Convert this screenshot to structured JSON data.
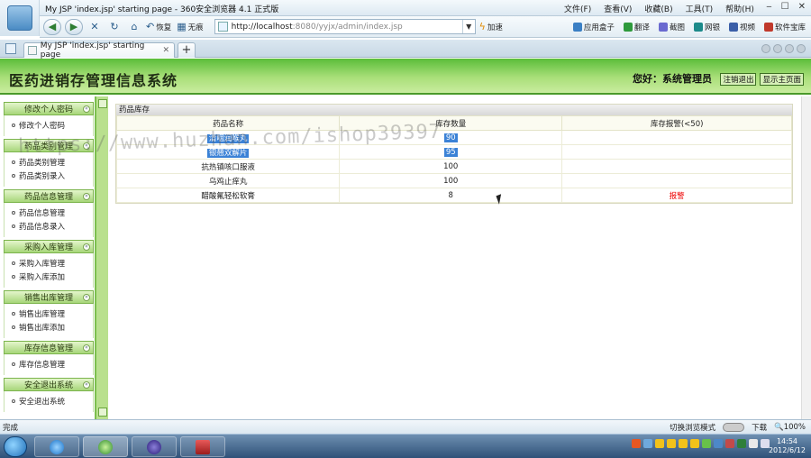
{
  "browser": {
    "window_title": "My JSP 'index.jsp' starting page - 360安全浏览器 4.1 正式版",
    "menus": [
      "文件(F)",
      "查看(V)",
      "收藏(B)",
      "工具(T)",
      "帮助(H)"
    ],
    "toolbar": {
      "restore": "恢复",
      "trace": "无痕",
      "speed": "加速",
      "url_host": "http://localhost",
      "url_rest": ":8080/yyjx/admin/index.jsp",
      "apps": [
        "应用盒子",
        "翻译",
        "截图",
        "网银",
        "视频",
        "软件宝库"
      ]
    },
    "tab": {
      "label": "My JSP 'index.jsp' starting page"
    },
    "status": {
      "left": "完成",
      "compat": "切换浏览模式",
      "download": "下载",
      "zoom": "100%"
    }
  },
  "app": {
    "title": "医药进销存管理信息系统",
    "greeting": "您好：系统管理员",
    "links": {
      "logout": "注销退出",
      "home": "显示主页面"
    }
  },
  "sidebar": [
    {
      "title": "修改个人密码",
      "items": [
        "修改个人密码"
      ]
    },
    {
      "title": "药品类别管理",
      "items": [
        "药品类别管理",
        "药品类别录入"
      ]
    },
    {
      "title": "药品信息管理",
      "items": [
        "药品信息管理",
        "药品信息录入"
      ]
    },
    {
      "title": "采购入库管理",
      "items": [
        "采购入库管理",
        "采购入库添加"
      ]
    },
    {
      "title": "销售出库管理",
      "items": [
        "销售出库管理",
        "销售出库添加"
      ]
    },
    {
      "title": "库存信息管理",
      "items": [
        "库存信息管理"
      ]
    },
    {
      "title": "安全退出系统",
      "items": [
        "安全退出系统"
      ]
    }
  ],
  "inventory": {
    "panel_title": "药品库存",
    "headers": [
      "药品名称",
      "库存数量",
      "库存报警(<50)"
    ],
    "rows": [
      {
        "name": "清咽润喉丸",
        "qty": "90",
        "alarm": "",
        "selected": true
      },
      {
        "name": "银翘双解片",
        "qty": "95",
        "alarm": "",
        "selected": true
      },
      {
        "name": "抗热镇咳口服液",
        "qty": "100",
        "alarm": "",
        "selected": false
      },
      {
        "name": "乌鸡止痒丸",
        "qty": "100",
        "alarm": "",
        "selected": false
      },
      {
        "name": "醋酸氟轻松软膏",
        "qty": "8",
        "alarm": "报警",
        "selected": false
      }
    ]
  },
  "watermark": "https://www.huzhan.com/ishop39397",
  "taskbar": {
    "time": "14:54",
    "date": "2012/6/12"
  }
}
